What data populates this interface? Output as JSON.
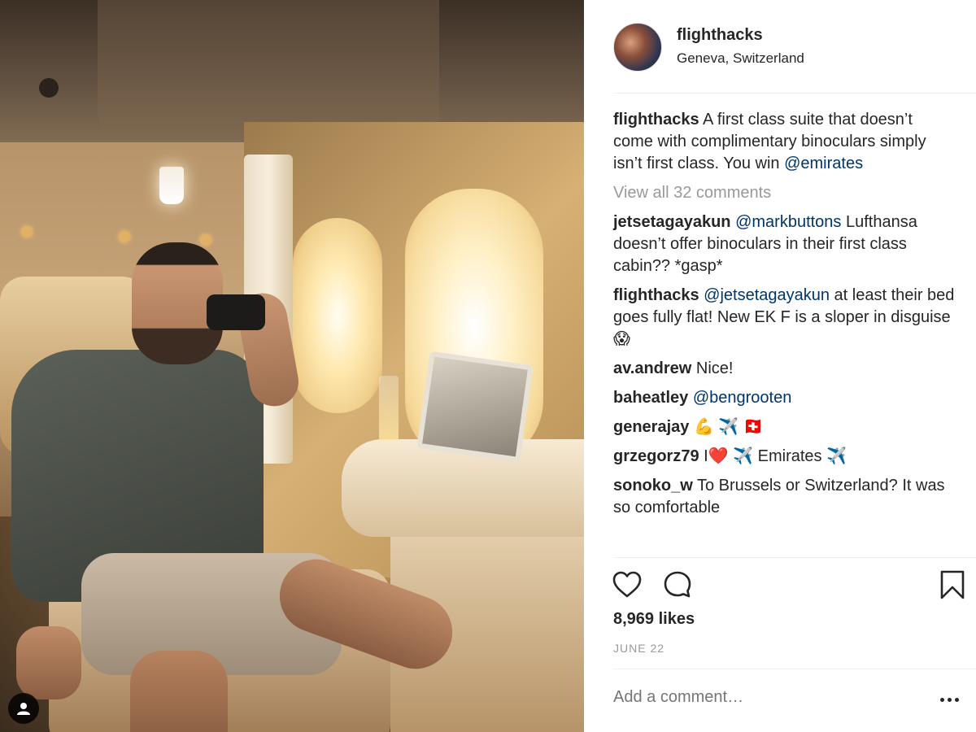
{
  "post": {
    "username": "flighthacks",
    "location": "Geneva, Switzerland"
  },
  "caption": {
    "username": "flighthacks",
    "text": "A first class suite that doesn’t come with complimentary binoculars simply isn’t first class. You win",
    "mention": "@emirates"
  },
  "view_all_comments": "View all 32 comments",
  "comments": [
    {
      "username": "jetsetagayakun",
      "mention": "@markbuttons",
      "text": "Lufthansa doesn’t offer binoculars in their first class cabin?? *gasp*"
    },
    {
      "username": "flighthacks",
      "mention": "@jetsetagayakun",
      "text": "at least their bed goes fully flat! New EK F is a sloper in disguise 😱"
    },
    {
      "username": "av.andrew",
      "mention": "",
      "text": "Nice!"
    },
    {
      "username": "baheatley",
      "mention": "@bengrooten",
      "text": ""
    },
    {
      "username": "generajay",
      "mention": "",
      "text": "💪 ✈️ 🇨🇭"
    },
    {
      "username": "grzegorz79",
      "mention": "",
      "text": "I❤️ ✈️ Emirates ✈️"
    },
    {
      "username": "sonoko_w",
      "mention": "",
      "text": "To Brussels or Switzerland? It was so comfortable"
    }
  ],
  "likes": "8,969 likes",
  "date": "JUNE 22",
  "add_comment_placeholder": "Add a comment…",
  "icons": {
    "like": "heart-icon",
    "comment": "comment-bubble-icon",
    "save": "bookmark-icon",
    "more": "more-options-icon",
    "tag": "user-tag-icon"
  },
  "colors": {
    "mention": "#003569",
    "muted": "#999999",
    "text": "#262626"
  }
}
